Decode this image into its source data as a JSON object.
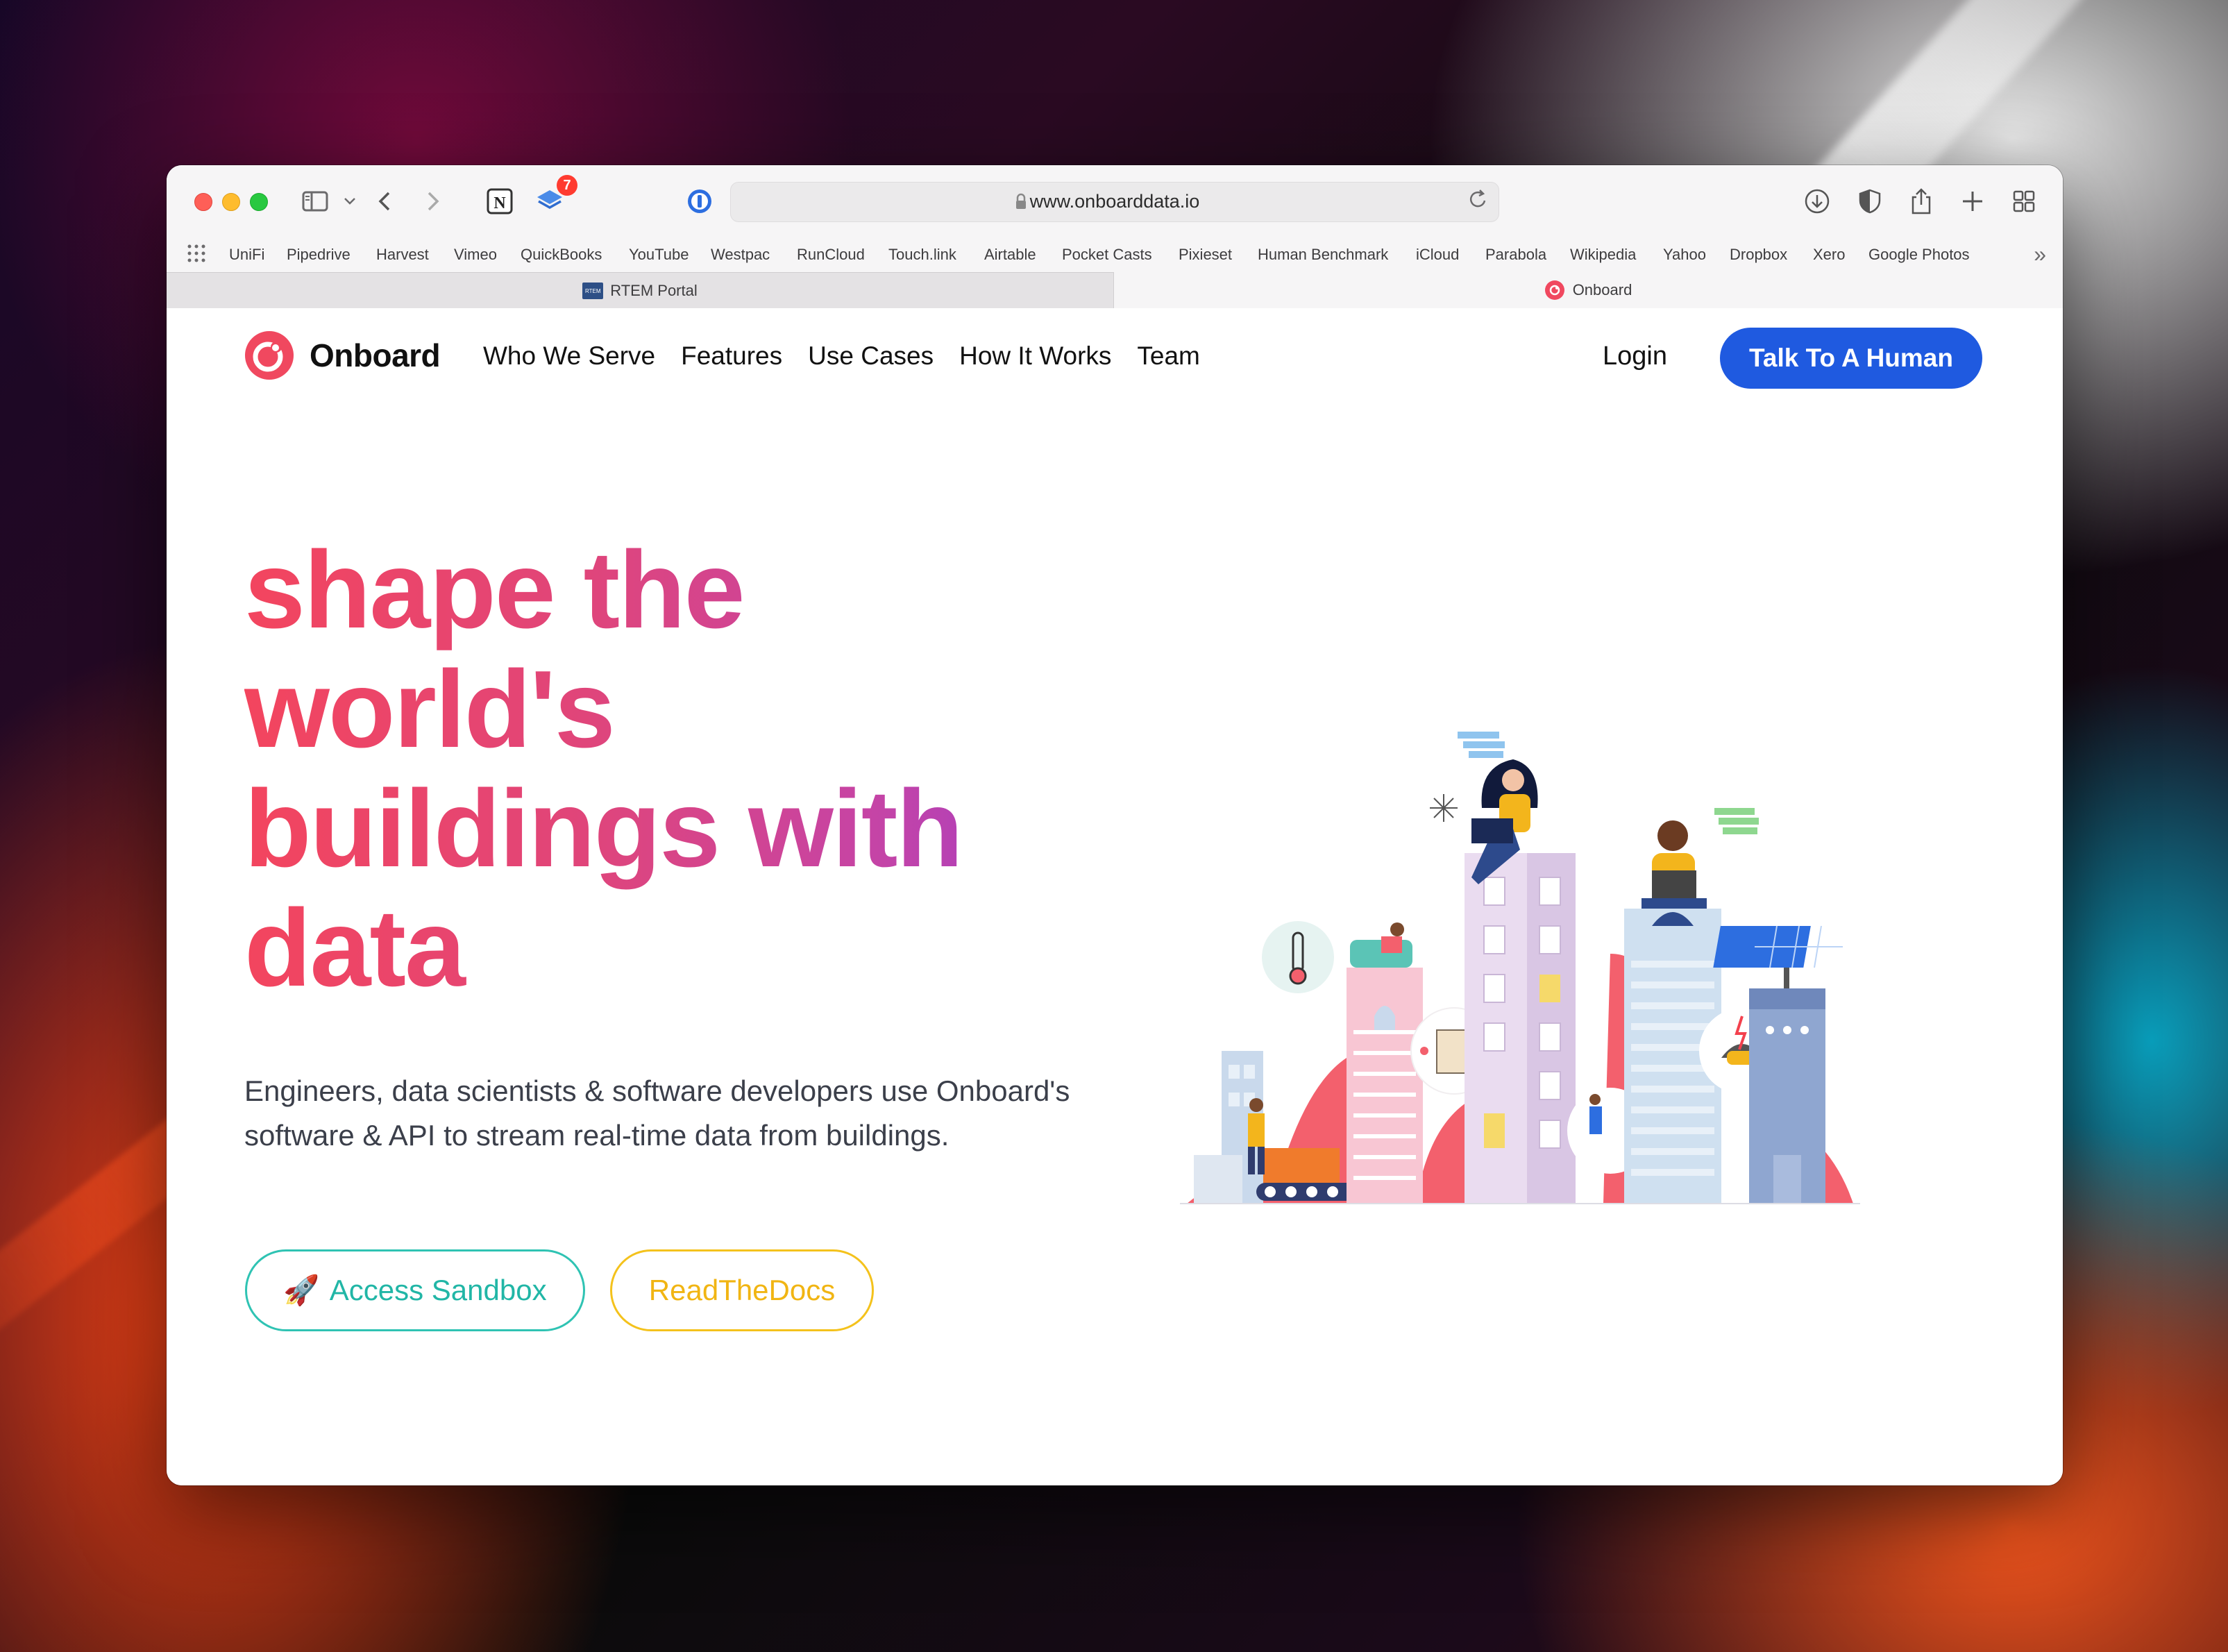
{
  "browser": {
    "url": "www.onboarddata.io",
    "toolbar_badge": "7",
    "bookmarks": [
      "UniFi",
      "Pipedrive",
      "Harvest",
      "Vimeo",
      "QuickBooks",
      "YouTube",
      "Westpac",
      "RunCloud",
      "Touch.link",
      "Airtable",
      "Pocket Casts",
      "Pixieset",
      "Human Benchmark",
      "iCloud",
      "Parabola",
      "Wikipedia",
      "Yahoo",
      "Dropbox",
      "Xero",
      "Google Photos"
    ],
    "tabs": [
      {
        "label": "RTEM Portal",
        "favicon_text": "RTEM",
        "active": false
      },
      {
        "label": "Onboard",
        "active": true
      }
    ]
  },
  "site": {
    "brand": "Onboard",
    "brand_color": "#f0485f",
    "nav": [
      "Who We Serve",
      "Features",
      "Use Cases",
      "How It Works",
      "Team"
    ],
    "login": "Login",
    "cta": "Talk To A Human",
    "cta_color": "#1f5ae0"
  },
  "hero": {
    "headline_lines": [
      "shape the",
      "world's",
      "buildings with",
      "data"
    ],
    "subhead": "Engineers, data scientists & software developers use Onboard's software & API to stream real-time data from buildings.",
    "btn_sandbox": "Access Sandbox",
    "btn_sandbox_icon": "🚀",
    "btn_docs": "ReadTheDocs",
    "sandbox_color": "#2fc3b3",
    "docs_color": "#f4c21c"
  }
}
